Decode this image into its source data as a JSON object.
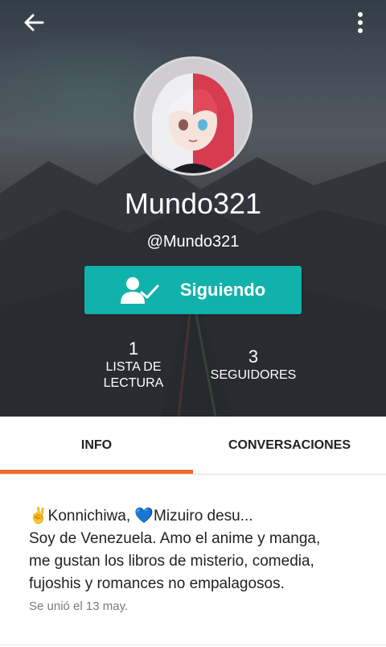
{
  "header": {
    "back_icon": "arrow-back-icon",
    "more_icon": "more-vertical-icon",
    "username": "Mundo321",
    "handle": "@Mundo321",
    "follow_button": {
      "label": "Siguiendo",
      "icon": "user-check-icon",
      "color": "#12b2ac"
    }
  },
  "stats": [
    {
      "value": "1",
      "label_line1": "LISTA DE",
      "label_line2": "LECTURA"
    },
    {
      "value": "3",
      "label": "SEGUIDORES"
    }
  ],
  "tabs": [
    {
      "label": "INFO",
      "active": true
    },
    {
      "label": "CONVERSACIONES",
      "active": false
    }
  ],
  "accent_color": "#ee6a2c",
  "bio": {
    "lines": [
      "✌️Konnichiwa, 💙Mizuiro desu...",
      "Soy de Venezuela. Amo el anime y manga,",
      "me gustan los libros de misterio, comedia,",
      "fujoshis y romances no empalagosos."
    ],
    "joined": "Se unió el 13 may."
  }
}
